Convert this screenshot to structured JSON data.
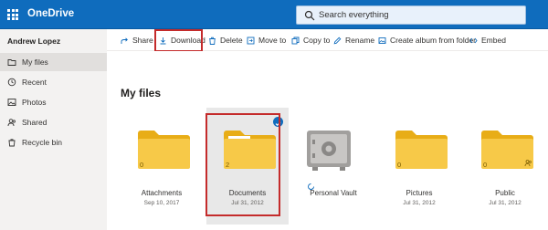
{
  "app": {
    "brand": "OneDrive",
    "accent": "#0f6cbd"
  },
  "search": {
    "placeholder": "Search everything"
  },
  "user": {
    "name": "Andrew Lopez"
  },
  "sidebar": {
    "items": [
      {
        "label": "My files",
        "icon": "folder-icon",
        "active": true
      },
      {
        "label": "Recent",
        "icon": "clock-icon"
      },
      {
        "label": "Photos",
        "icon": "image-icon"
      },
      {
        "label": "Shared",
        "icon": "people-icon"
      },
      {
        "label": "Recycle bin",
        "icon": "trash-icon"
      }
    ]
  },
  "toolbar": {
    "share": "Share",
    "download": "Download",
    "delete": "Delete",
    "move_to": "Move to",
    "copy_to": "Copy to",
    "rename": "Rename",
    "create_album": "Create album from folder",
    "embed": "Embed"
  },
  "main": {
    "heading": "My files",
    "files": [
      {
        "name": "Attachments",
        "date": "Sep 10, 2017",
        "count": "0",
        "type": "folder"
      },
      {
        "name": "Documents",
        "date": "Jul 31, 2012",
        "count": "2",
        "type": "folder",
        "selected": true
      },
      {
        "name": "Personal Vault",
        "date": "",
        "type": "vault"
      },
      {
        "name": "Pictures",
        "date": "Jul 31, 2012",
        "count": "0",
        "type": "folder"
      },
      {
        "name": "Public",
        "date": "Jul 31, 2012",
        "count": "0",
        "type": "folder",
        "shared": true
      }
    ]
  },
  "colors": {
    "folder": "#f7c948",
    "folder_dark": "#e8ad17",
    "highlight": "#c42b2b"
  }
}
